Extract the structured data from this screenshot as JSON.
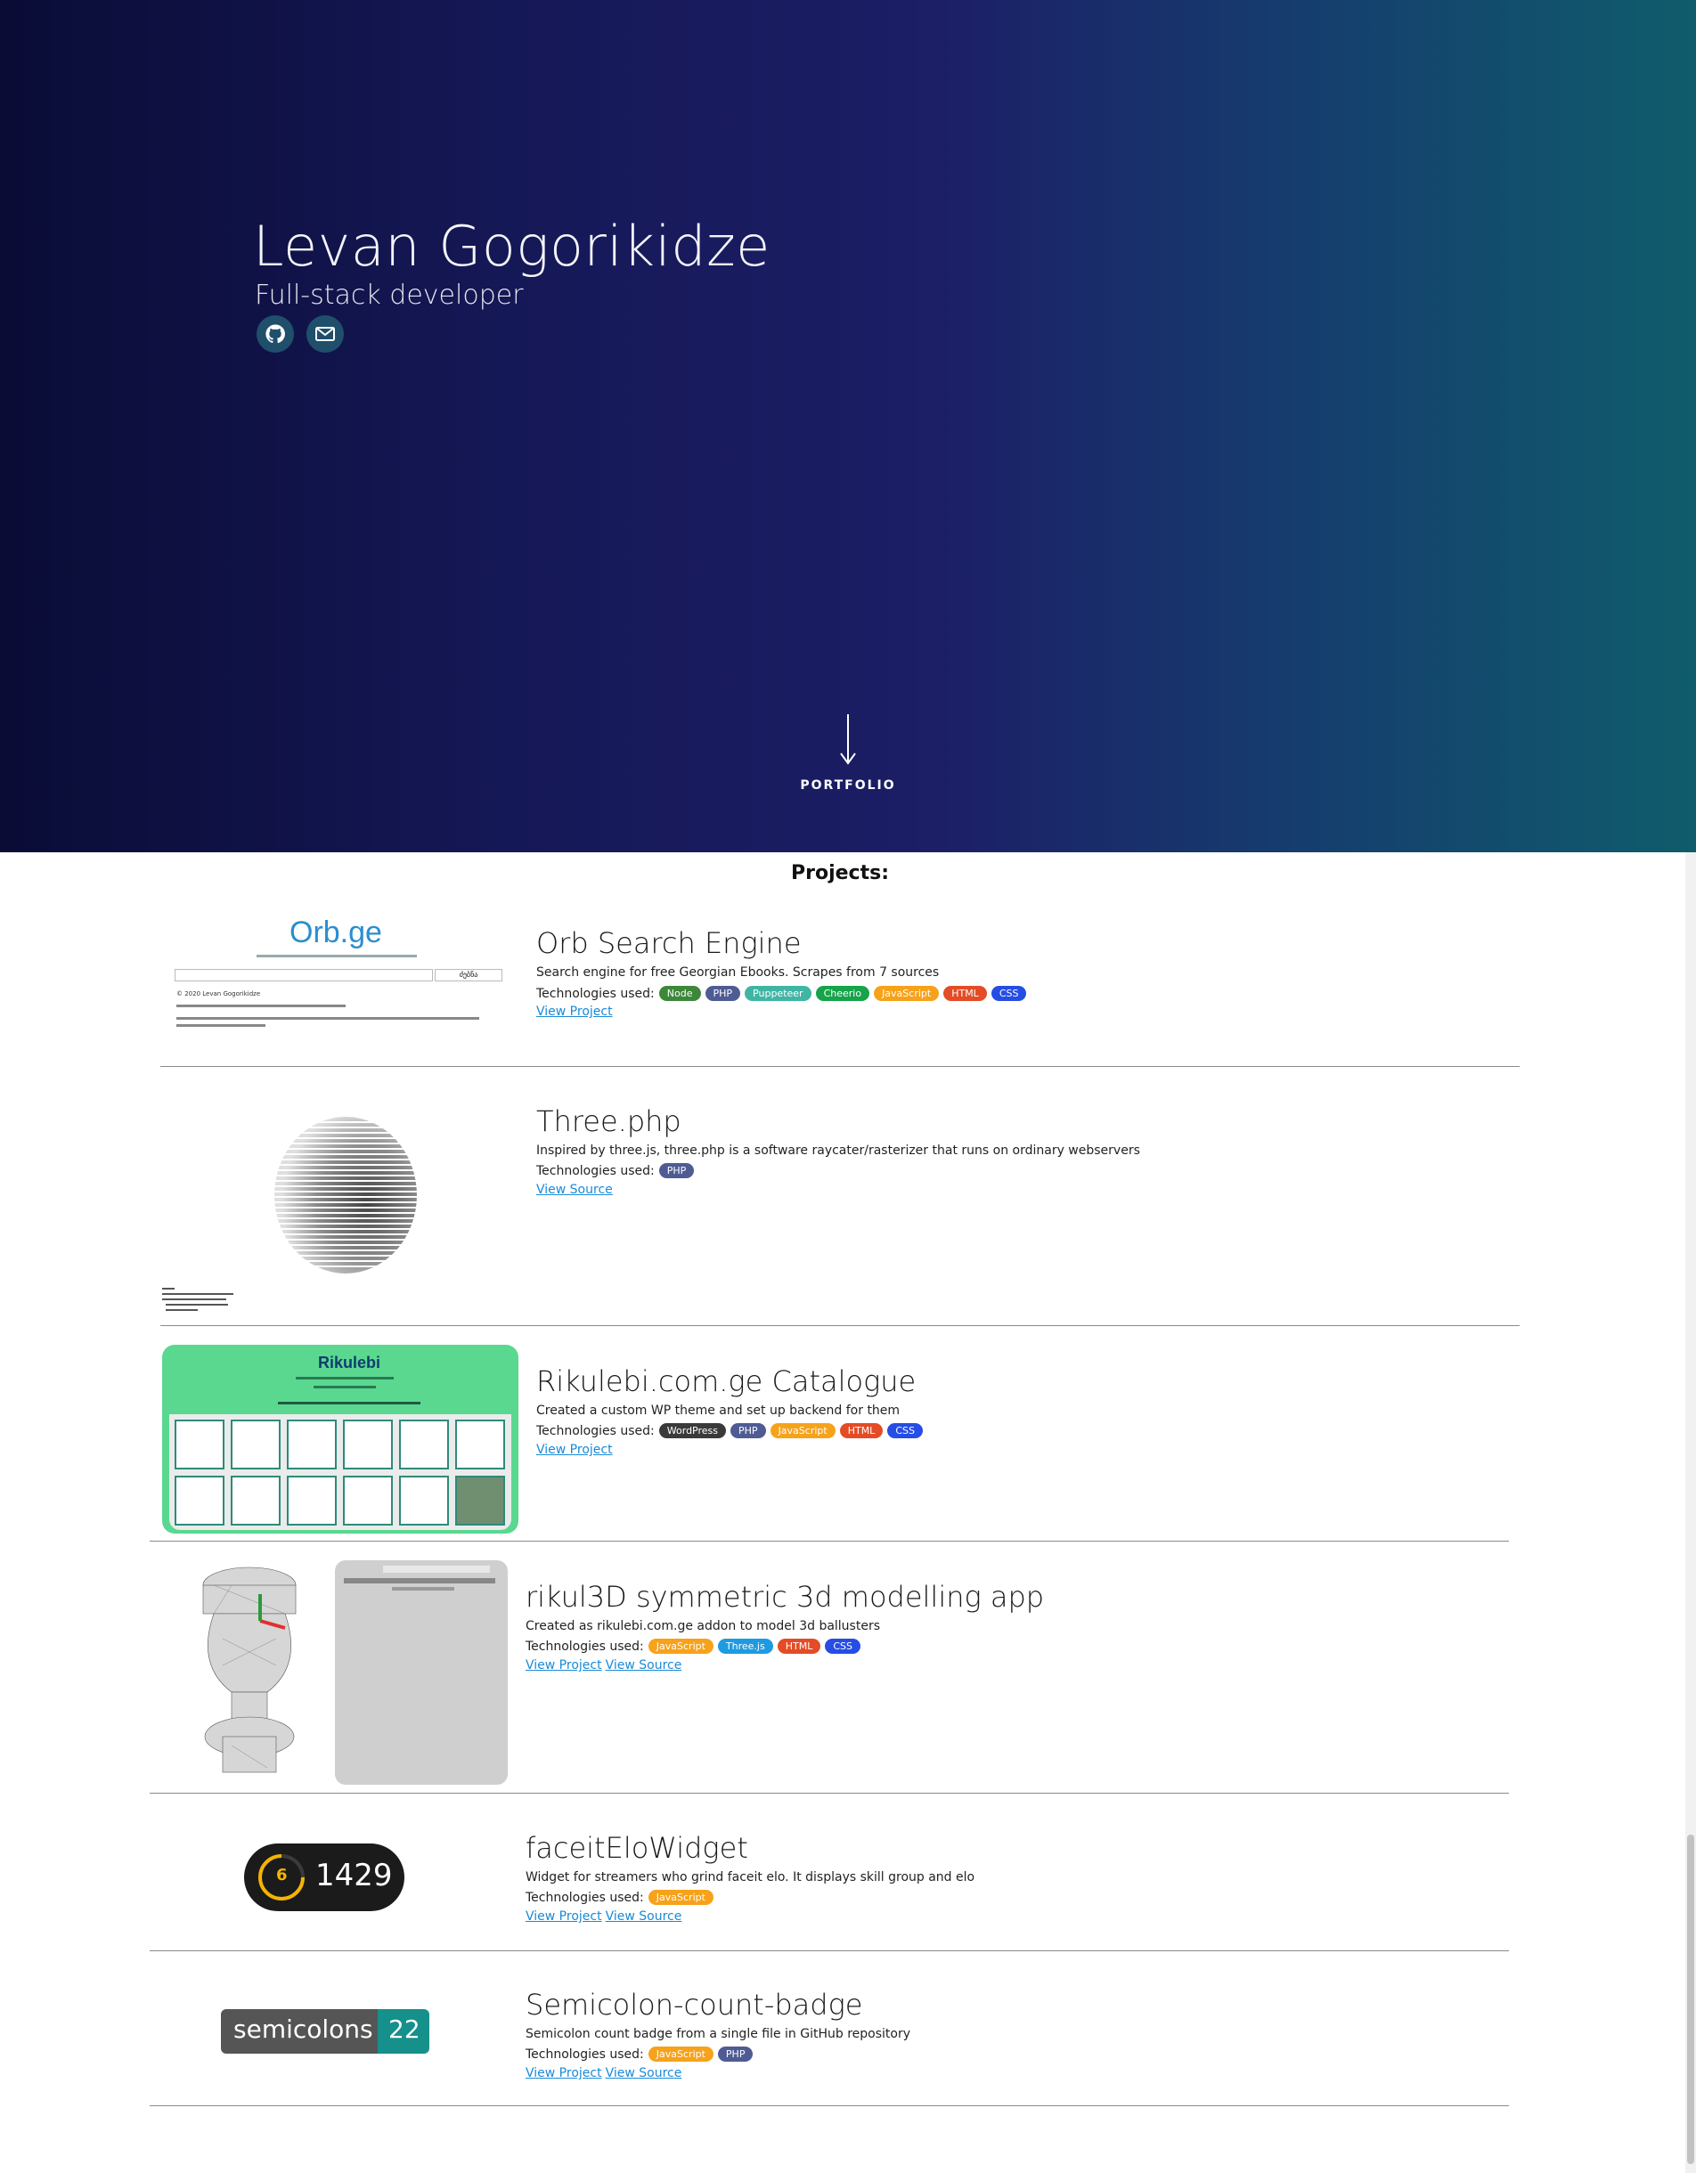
{
  "hero": {
    "name": "Levan Gogorikidze",
    "role": "Full-stack developer",
    "icons": [
      "github-icon",
      "mail-icon"
    ],
    "scroll_label": "PORTFOLIO"
  },
  "projects_heading": "Projects:",
  "tech_colors": {
    "Node": "#3c873a",
    "PHP": "#4f5b93",
    "Puppeteer": "#40b5a4",
    "Cheerio": "#16a34a",
    "JavaScript": "#f7a21b",
    "HTML": "#e34c26",
    "CSS": "#264de4",
    "WordPress": "#3a3a3a",
    "Three.js": "#1e9be0"
  },
  "tech_label": "Technologies used:",
  "projects": [
    {
      "title": "Orb Search Engine",
      "description": "Search engine for free Georgian Ebooks. Scrapes from 7 sources",
      "tech": [
        "Node",
        "PHP",
        "Puppeteer",
        "Cheerio",
        "JavaScript",
        "HTML",
        "CSS"
      ],
      "links": [
        "View Project"
      ],
      "thumb": {
        "logo": "Orb.ge",
        "button": "ძებნა",
        "footer": "© 2020 Levan Gogorikidze"
      }
    },
    {
      "title": "Three.php",
      "description": "Inspired by three.js, three.php is a software raycater/rasterizer that runs on ordinary webservers",
      "tech": [
        "PHP"
      ],
      "links": [
        "View Source"
      ]
    },
    {
      "title": "Rikulebi.com.ge Catalogue",
      "description": "Created a custom WP theme and set up backend for them",
      "tech": [
        "WordPress",
        "PHP",
        "JavaScript",
        "HTML",
        "CSS"
      ],
      "links": [
        "View Project"
      ],
      "thumb": {
        "logo": "Rikulebi"
      }
    },
    {
      "title": "rikul3D symmetric 3d modelling app",
      "description": "Created as rikulebi.com.ge addon to model 3d ballusters",
      "tech": [
        "JavaScript",
        "Three.js",
        "HTML",
        "CSS"
      ],
      "links": [
        "View Project",
        "View Source"
      ]
    },
    {
      "title": "faceitEloWidget",
      "description": "Widget for streamers who grind faceit elo. It displays skill group and elo",
      "tech": [
        "JavaScript"
      ],
      "links": [
        "View Project",
        "View Source"
      ],
      "thumb": {
        "level": "6",
        "elo": "1429"
      }
    },
    {
      "title": "Semicolon-count-badge",
      "description": "Semicolon count badge from a single file in GitHub repository",
      "tech": [
        "JavaScript",
        "PHP"
      ],
      "links": [
        "View Project",
        "View Source"
      ],
      "thumb": {
        "label": "semicolons",
        "count": "22"
      }
    }
  ]
}
